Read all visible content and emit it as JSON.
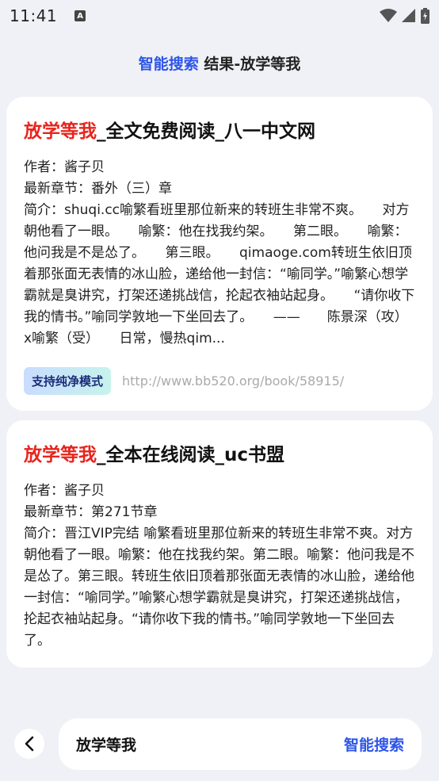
{
  "status_bar": {
    "time": "11:41",
    "notification_glyph": "A"
  },
  "header": {
    "accent": "智能搜索",
    "title": " 结果-放学等我"
  },
  "results": [
    {
      "title_highlight": "放学等我",
      "title_rest": "_全文免费阅读_八一中文网",
      "author": "作者：酱子贝",
      "latest_chapter": "最新章节：番外（三）章",
      "summary": "简介：shuqi.cc喻繁看班里那位新来的转班生非常不爽。　　对方朝他看了一眼。　　喻繁：他在找我约架。　　第二眼。　　喻繁：他问我是不是怂了。　　第三眼。　　qimaoge.com转班生依旧顶着那张面无表情的冰山脸，递给他一封信：“喻同学。”喻繁心想学霸就是臭讲究，打架还递挑战信，抡起衣袖站起身。　　“请你收下我的情书。”喻同学敦地一下坐回去了。　　——　　陈景深（攻）x喻繁（受）　　日常，慢热qim...",
      "badge": "支持纯净模式",
      "url": "http://www.bb520.org/book/58915/"
    },
    {
      "title_highlight": "放学等我",
      "title_rest": "_全本在线阅读_uc书盟",
      "author": "作者：酱子贝",
      "latest_chapter": "最新章节：第271节章",
      "summary": "简介：晋江VIP完结 喻繁看班里那位新来的转班生非常不爽。对方朝他看了一眼。喻繁：他在找我约架。第二眼。喻繁：他问我是不是怂了。第三眼。转班生依旧顶着那张面无表情的冰山脸，递给他一封信：“喻同学。”喻繁心想学霸就是臭讲究，打架还递挑战信，抡起衣袖站起身。“请你收下我的情书。”喻同学敦地一下坐回去了。"
    }
  ],
  "bottom_bar": {
    "query": "放学等我",
    "search_button": "智能搜索"
  },
  "colors": {
    "accent": "#2d55e8",
    "highlight": "#e8241c",
    "background": "#f0f1f6"
  },
  "icons": {
    "back": "chevron-left-icon",
    "wifi": "wifi-icon",
    "signal": "signal-icon",
    "battery": "battery-charging-icon"
  }
}
